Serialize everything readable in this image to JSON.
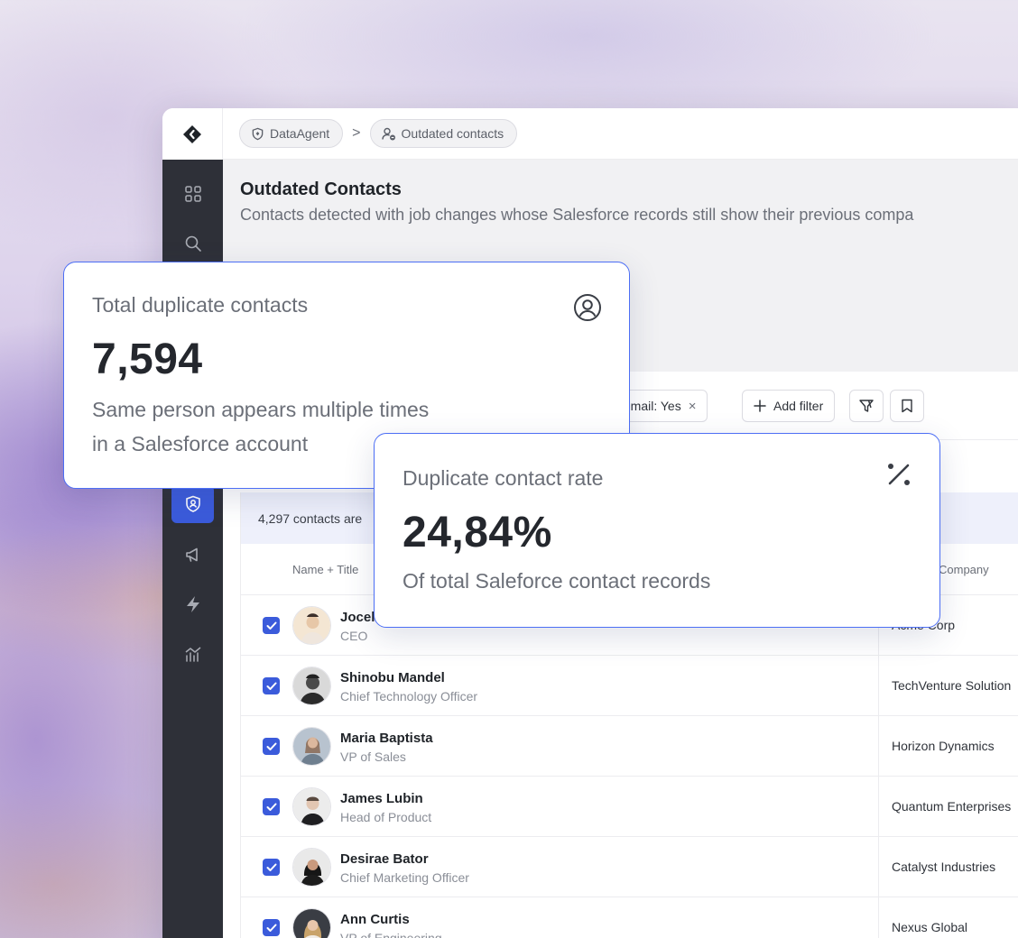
{
  "breadcrumb": {
    "items": [
      {
        "label": "DataAgent",
        "icon": "shield-icon"
      },
      {
        "label": "Outdated contacts",
        "icon": "user-minus-icon"
      }
    ],
    "separator": ">"
  },
  "sidebar": {
    "items": [
      "grid-icon",
      "search-icon",
      "shield-user-icon",
      "megaphone-icon",
      "lightning-icon",
      "chart-icon"
    ],
    "active": "shield-user-icon"
  },
  "page": {
    "title": "Outdated Contacts",
    "description": "Contacts detected with job changes whose Salesforce records still show their previous compa"
  },
  "filters": {
    "chips": [
      {
        "label": "y email: Yes",
        "removable": true
      }
    ],
    "add_filter_label": "Add filter"
  },
  "table": {
    "selection_banner": "4,297 contacts are",
    "columns": {
      "name": "Name + Title",
      "company": "Company"
    },
    "rows": [
      {
        "name": "Jocel",
        "title": "CEO",
        "company": "Acme Corp",
        "checked": true
      },
      {
        "name": "Shinobu Mandel",
        "title": "Chief Technology Officer",
        "company": "TechVenture Solution",
        "checked": true
      },
      {
        "name": "Maria Baptista",
        "title": "VP of Sales",
        "company": "Horizon Dynamics",
        "checked": true
      },
      {
        "name": "James Lubin",
        "title": "Head of Product",
        "company": "Quantum Enterprises",
        "checked": true
      },
      {
        "name": "Desirae Bator",
        "title": "Chief Marketing Officer",
        "company": "Catalyst Industries",
        "checked": true
      },
      {
        "name": "Ann Curtis",
        "title": "VP of Engineering",
        "company": "Nexus Global",
        "checked": true
      }
    ]
  },
  "cards": [
    {
      "label": "Total duplicate contacts",
      "value": "7,594",
      "description_line1": "Same person appears multiple times",
      "description_line2": "in a Salesforce account",
      "icon": "user-circle-icon"
    },
    {
      "label": "Duplicate contact rate",
      "value": "24,84%",
      "description_line1": "Of total Saleforce contact records",
      "icon": "percent-icon"
    }
  ],
  "colors": {
    "accent": "#3b5bdb",
    "sidebar": "#2e3038",
    "card_border": "#4c6ef5"
  }
}
